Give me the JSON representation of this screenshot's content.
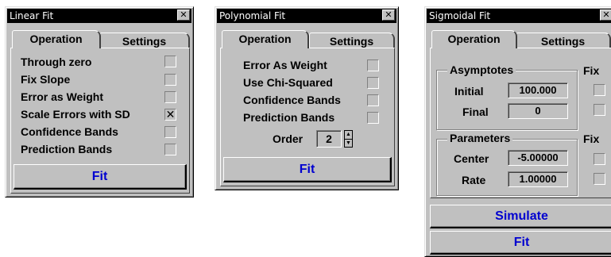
{
  "linear": {
    "title": "Linear Fit",
    "close": "✕",
    "tabs": [
      "Operation",
      "Settings"
    ],
    "options": [
      {
        "label": "Through zero",
        "checked": false
      },
      {
        "label": "Fix Slope",
        "checked": false
      },
      {
        "label": "Error as Weight",
        "checked": false
      },
      {
        "label": "Scale Errors with SD",
        "checked": true,
        "mark": "✕"
      },
      {
        "label": "Confidence Bands",
        "checked": false
      },
      {
        "label": "Prediction Bands",
        "checked": false
      }
    ],
    "fit_label": "Fit"
  },
  "polynomial": {
    "title": "Polynomial Fit",
    "close": "✕",
    "tabs": [
      "Operation",
      "Settings"
    ],
    "options": [
      {
        "label": "Error As Weight",
        "checked": false
      },
      {
        "label": "Use Chi-Squared",
        "checked": false
      },
      {
        "label": "Confidence Bands",
        "checked": false
      },
      {
        "label": "Prediction Bands",
        "checked": false
      }
    ],
    "order_label": "Order",
    "order_value": "2",
    "fit_label": "Fit"
  },
  "sigmoidal": {
    "title": "Sigmoidal Fit",
    "close": "✕",
    "tabs": [
      "Operation",
      "Settings"
    ],
    "asymptotes": {
      "label": "Asymptotes",
      "fix_label": "Fix",
      "initial_label": "Initial",
      "initial_value": "100.000",
      "final_label": "Final",
      "final_value": "0"
    },
    "parameters": {
      "label": "Parameters",
      "fix_label": "Fix",
      "center_label": "Center",
      "center_value": "-5.00000",
      "rate_label": "Rate",
      "rate_value": "1.00000"
    },
    "simulate_label": "Simulate",
    "fit_label": "Fit"
  },
  "colors": {
    "button_text": "#0000d0",
    "face": "#c0c0c0",
    "title_bg": "#000000"
  }
}
